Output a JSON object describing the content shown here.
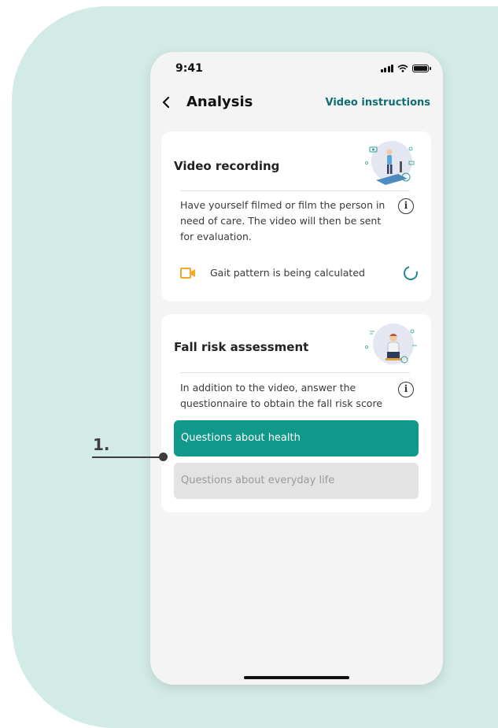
{
  "status_bar": {
    "time": "9:41"
  },
  "nav": {
    "back_icon": "chevron-left-icon",
    "title": "Analysis",
    "link_label": "Video instructions"
  },
  "video_card": {
    "title": "Video recording",
    "description": "Have yourself filmed or film the person in need of care. The video will then be sent for evaluation.",
    "status_text": "Gait pattern is being calculated",
    "status_icon": "video-camera-icon",
    "info_glyph": "i"
  },
  "fall_card": {
    "title": "Fall risk assessment",
    "description": "In addition to the video, answer the questionnaire to obtain the fall risk score",
    "info_glyph": "i",
    "questions_health_label": "Questions about health",
    "questions_life_label": "Questions about everyday life"
  },
  "callout": {
    "label": "1."
  },
  "colors": {
    "background_blob": "#d3ebe6",
    "accent": "#10988a",
    "link": "#0f6e73",
    "camera_icon": "#f5a623",
    "disabled_button": "#e3e3e3"
  }
}
